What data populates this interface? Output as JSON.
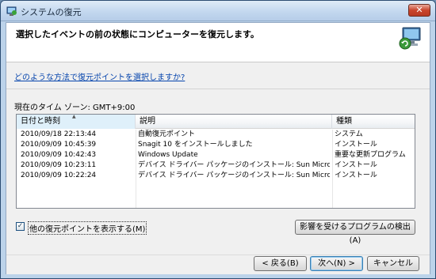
{
  "window": {
    "title": "システムの復元",
    "close_label": "✕",
    "icon_name": "system-restore-icon"
  },
  "header": {
    "text": "選択したイベントの前の状態にコンピューターを復元します。",
    "icon_name": "monitor-restore-icon"
  },
  "link": {
    "text": "どのような方法で復元ポイントを選択しますか?"
  },
  "timezone": {
    "text": "現在のタイム ゾーン: GMT+9:00"
  },
  "table": {
    "columns": [
      "日付と時刻",
      "説明",
      "種類"
    ],
    "rows": [
      [
        "2010/09/18 22:13:44",
        "自動復元ポイント",
        "システム"
      ],
      [
        "2010/09/09 10:45:39",
        "Snagit 10 をインストールしました",
        "インストール"
      ],
      [
        "2010/09/09 10:42:43",
        "Windows Update",
        "重要な更新プログラム"
      ],
      [
        "2010/09/09 10:23:11",
        "デバイス ドライバー パッケージのインストール: Sun Microsyst...",
        "インストール"
      ],
      [
        "2010/09/09 10:22:24",
        "デバイス ドライバー パッケージのインストール: Sun Microsyst...",
        "インストール"
      ]
    ]
  },
  "checkbox": {
    "label": "他の復元ポイントを表示する(M)",
    "checked": true,
    "mark": "✓"
  },
  "buttons": {
    "detect": "影響を受けるプログラムの検出(A)",
    "back": "< 戻る(B)",
    "next": "次へ(N) >",
    "cancel": "キャンセル"
  },
  "colors": {
    "link": "#0645ad",
    "title_bar": "#c3d8ef",
    "close_button": "#c9452c"
  }
}
